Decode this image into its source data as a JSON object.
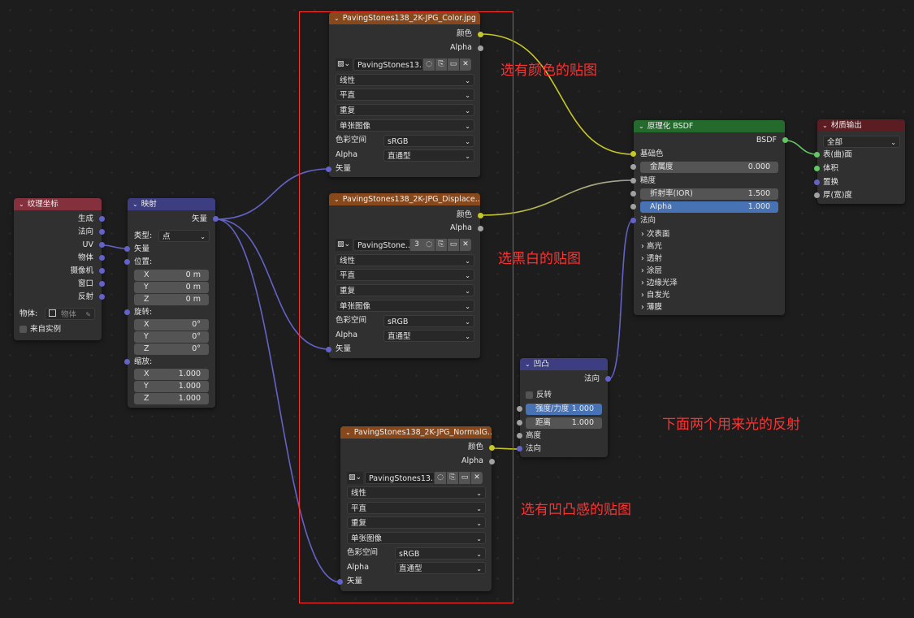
{
  "colors": {
    "wire_yellow": "#c7c729",
    "wire_gray": "#a1a1a1",
    "wire_purple": "#6363c7",
    "wire_green": "#63c763",
    "highlight_box": "#ff3232",
    "annotation": "#ff3232"
  },
  "texcoord": {
    "title": "纹理坐标",
    "outputs": [
      "生成",
      "法向",
      "UV",
      "物体",
      "摄像机",
      "窗口",
      "反射"
    ],
    "object_label": "物体:",
    "object_placeholder": "物体",
    "from_instancer": "来自实例"
  },
  "mapping": {
    "title": "映射",
    "out_vector": "矢量",
    "type_label": "类型:",
    "type_value": "点",
    "in_vector": "矢量",
    "location_label": "位置:",
    "location": [
      {
        "axis": "X",
        "value": "0 m"
      },
      {
        "axis": "Y",
        "value": "0 m"
      },
      {
        "axis": "Z",
        "value": "0 m"
      }
    ],
    "rotation_label": "旋转:",
    "rotation": [
      {
        "axis": "X",
        "value": "0°"
      },
      {
        "axis": "Y",
        "value": "0°"
      },
      {
        "axis": "Z",
        "value": "0°"
      }
    ],
    "scale_label": "缩放:",
    "scale": [
      {
        "axis": "X",
        "value": "1.000"
      },
      {
        "axis": "Y",
        "value": "1.000"
      },
      {
        "axis": "Z",
        "value": "1.000"
      }
    ]
  },
  "img1": {
    "title": "PavingStones138_2K-JPG_Color.jpg",
    "out_color": "颜色",
    "out_alpha": "Alpha",
    "image_name": "PavingStones13...",
    "users": "",
    "interpolation": "线性",
    "projection": "平直",
    "extension": "重复",
    "source": "单张图像",
    "colorspace_label": "色彩空间",
    "colorspace": "sRGB",
    "alpha_label": "Alpha",
    "alpha": "直通型",
    "in_vector": "矢量"
  },
  "img2": {
    "title": "PavingStones138_2K-JPG_Displace...",
    "out_color": "颜色",
    "out_alpha": "Alpha",
    "image_name": "PavingStone...",
    "users": "3",
    "interpolation": "线性",
    "projection": "平直",
    "extension": "重复",
    "source": "单张图像",
    "colorspace_label": "色彩空间",
    "colorspace": "sRGB",
    "alpha_label": "Alpha",
    "alpha": "直通型",
    "in_vector": "矢量"
  },
  "img3": {
    "title": "PavingStones138_2K-JPG_NormalG...",
    "out_color": "颜色",
    "out_alpha": "Alpha",
    "image_name": "PavingStones13...",
    "users": "",
    "interpolation": "线性",
    "projection": "平直",
    "extension": "重复",
    "source": "单张图像",
    "colorspace_label": "色彩空间",
    "colorspace": "sRGB",
    "alpha_label": "Alpha",
    "alpha": "直通型",
    "in_vector": "矢量"
  },
  "bump": {
    "title": "凹凸",
    "out_normal": "法向",
    "invert": "反转",
    "strength_label": "强度/力度",
    "strength": "1.000",
    "distance_label": "距离",
    "distance": "1.000",
    "height": "高度",
    "normal": "法向"
  },
  "bsdf": {
    "title": "原理化 BSDF",
    "out": "BSDF",
    "base_color": "基础色",
    "metallic_label": "金属度",
    "metallic": "0.000",
    "roughness": "糙度",
    "ior_label": "折射率(IOR)",
    "ior": "1.500",
    "alpha_label": "Alpha",
    "alpha": "1.000",
    "normal": "法向",
    "panels": [
      "次表面",
      "高光",
      "透射",
      "涂层",
      "边缘光泽",
      "自发光",
      "薄膜"
    ]
  },
  "output": {
    "title": "材质输出",
    "target": "全部",
    "surface": "表(曲)面",
    "volume": "体积",
    "displacement": "置换",
    "thickness": "厚(宽)度"
  },
  "annotations": {
    "color_map": "选有颜色的贴图",
    "bw_map": "选黑白的贴图",
    "bump_map": "选有凹凸感的贴图",
    "bottom_two": "下面两个用来光的反射"
  }
}
